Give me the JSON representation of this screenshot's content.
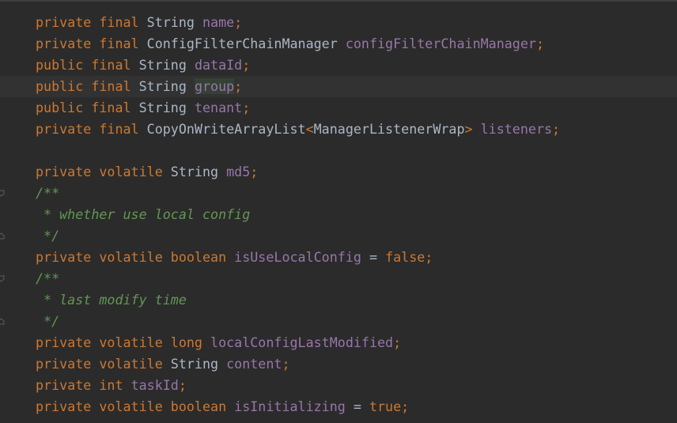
{
  "editor": {
    "lines": [
      {
        "tokens": [
          [
            "kw",
            "private final "
          ],
          [
            "type",
            "String "
          ],
          [
            "field",
            "name"
          ],
          [
            "punc",
            ";"
          ]
        ]
      },
      {
        "tokens": [
          [
            "kw",
            "private final "
          ],
          [
            "type",
            "ConfigFilterChainManager "
          ],
          [
            "field",
            "configFilterChainManager"
          ],
          [
            "punc",
            ";"
          ]
        ]
      },
      {
        "tokens": [
          [
            "kw",
            "public final "
          ],
          [
            "type",
            "String "
          ],
          [
            "field",
            "dataId"
          ],
          [
            "punc",
            ";"
          ]
        ]
      },
      {
        "current": true,
        "tokens": [
          [
            "kw",
            "public final "
          ],
          [
            "type",
            "String "
          ],
          [
            "field-hl",
            "group"
          ],
          [
            "punc",
            ";"
          ]
        ]
      },
      {
        "tokens": [
          [
            "kw",
            "public final "
          ],
          [
            "type",
            "String "
          ],
          [
            "field",
            "tenant"
          ],
          [
            "punc",
            ";"
          ]
        ]
      },
      {
        "tokens": [
          [
            "kw",
            "private final "
          ],
          [
            "type",
            "CopyOnWriteArrayList"
          ],
          [
            "punc",
            "<"
          ],
          [
            "type",
            "ManagerListenerWrap"
          ],
          [
            "punc",
            "> "
          ],
          [
            "field",
            "listeners"
          ],
          [
            "punc",
            ";"
          ]
        ]
      },
      {
        "tokens": []
      },
      {
        "tokens": [
          [
            "kw",
            "private volatile "
          ],
          [
            "type",
            "String "
          ],
          [
            "field",
            "md5"
          ],
          [
            "punc",
            ";"
          ]
        ]
      },
      {
        "fold": "start",
        "tokens": [
          [
            "comment",
            "/**"
          ]
        ]
      },
      {
        "tokens": [
          [
            "comment",
            " * whether use local config"
          ]
        ]
      },
      {
        "fold": "end",
        "tokens": [
          [
            "comment",
            " */"
          ]
        ]
      },
      {
        "tokens": [
          [
            "kw",
            "private volatile boolean "
          ],
          [
            "field",
            "isUseLocalConfig "
          ],
          [
            "op",
            "= "
          ],
          [
            "kw",
            "false;"
          ]
        ]
      },
      {
        "fold": "start",
        "tokens": [
          [
            "comment",
            "/**"
          ]
        ]
      },
      {
        "tokens": [
          [
            "comment",
            " * last modify time"
          ]
        ]
      },
      {
        "fold": "end",
        "tokens": [
          [
            "comment",
            " */"
          ]
        ]
      },
      {
        "tokens": [
          [
            "kw",
            "private volatile long "
          ],
          [
            "field",
            "localConfigLastModified"
          ],
          [
            "punc",
            ";"
          ]
        ]
      },
      {
        "tokens": [
          [
            "kw",
            "private volatile "
          ],
          [
            "type",
            "String "
          ],
          [
            "field",
            "content"
          ],
          [
            "punc",
            ";"
          ]
        ]
      },
      {
        "tokens": [
          [
            "kw",
            "private int "
          ],
          [
            "field",
            "taskId"
          ],
          [
            "punc",
            ";"
          ]
        ]
      },
      {
        "tokens": [
          [
            "kw",
            "private volatile boolean "
          ],
          [
            "field",
            "isInitializing "
          ],
          [
            "op",
            "= "
          ],
          [
            "kw",
            "true;"
          ]
        ]
      }
    ]
  },
  "colors": {
    "background": "#2b2b2b",
    "current_line": "#323232",
    "keyword": "#cc7832",
    "field": "#9876aa",
    "text": "#a9b7c6",
    "comment": "#629755"
  },
  "icons": {
    "fold_start": "fold-start-icon",
    "fold_end": "fold-end-icon"
  }
}
